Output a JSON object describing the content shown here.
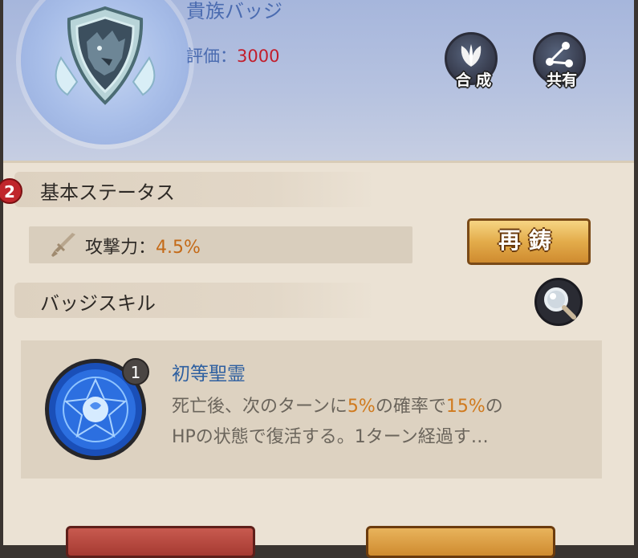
{
  "item": {
    "name": "貴族バッジ",
    "rating_label": "評価：",
    "rating_value": "3000"
  },
  "actions": {
    "compose_label": "合 成",
    "share_label": "共有"
  },
  "notification_count": "2",
  "basic_status": {
    "title": "基本ステータス",
    "stat_label": "攻撃力：",
    "stat_value": "4.5%",
    "reforge_label": "再鋳"
  },
  "badge_skill": {
    "title": "バッジスキル",
    "skill_level": "1",
    "skill_name": "初等聖霊",
    "desc_1": "死亡後、次のターンに",
    "desc_hl_1": "5%",
    "desc_2": "の確率で",
    "desc_hl_2": "15%",
    "desc_3": "の",
    "desc_line2": "HPの状態で復活する。1ターン経過す…"
  },
  "colors": {
    "accent_blue": "#4a6bb0",
    "rating_red": "#c21d2b",
    "highlight_orange": "#c46a18"
  },
  "icons": [
    "badge-shield-icon",
    "leaf-icon",
    "share-icon",
    "sword-icon",
    "magnify-icon",
    "spirit-orb-icon"
  ]
}
